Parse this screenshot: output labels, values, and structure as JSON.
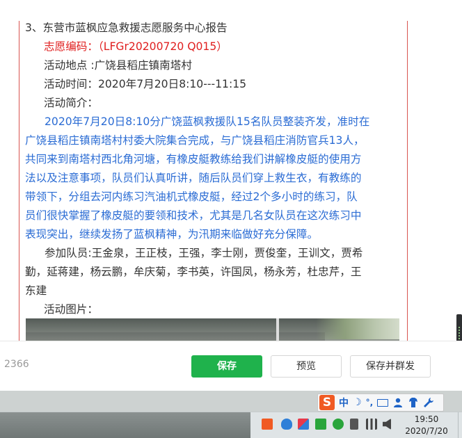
{
  "document": {
    "heading": "3、东营市蓝枫应急救援志愿服务中心报告",
    "code_line": "志愿编码：（LFGr20200720 Q015）",
    "location": "活动地点 :广饶县稻庄镇南塔村",
    "time": "活动时间：2020年7月20日8:10---11:15",
    "intro_label": "活动简介：",
    "intro_lines": [
      "2020年7月20日8:10分广饶蓝枫救援队15名队员整装齐发，准时在",
      "广饶县稻庄镇南塔村村委大院集合完成，与广饶县稻庄消防官兵13人，",
      "共同来到南塔村西北角河塘，有橡皮艇教练给我们讲解橡皮艇的使用方",
      "法以及注意事项，队员们认真听讲，随后队员们穿上救生衣，有教练的",
      "带领下，分组去河内练习汽油机式橡皮艇，经过2个多小时的练习，队",
      "员们很快掌握了橡皮艇的要领和技术，尤其是几名女队员在这次练习中",
      "表现突出，继续发扬了蓝枫精神，为汛期来临做好充分保障。"
    ],
    "members_lines": [
      "参加队员:王金泉，王正枝，王强，李士刚，贾俊奎，王训文，贾希",
      "勤，延蒋建，杨云鹏，牟庆菊，李书英，许国凤，杨永芳，杜忠芹，王",
      "东建"
    ],
    "photos_label": "活动图片："
  },
  "actionbar": {
    "count": "2366",
    "save": "保存",
    "preview": "预览",
    "save_mass": "保存并群发"
  },
  "ime": {
    "logo": "S",
    "lang": "中",
    "moon": "☽",
    "punct": "°,"
  },
  "taskbar": {
    "time": "19:50",
    "date": "2020/7/20"
  },
  "colors": {
    "accent_green": "#1fb24c",
    "body_blue": "#2b6cd4",
    "code_red": "#e02020"
  }
}
